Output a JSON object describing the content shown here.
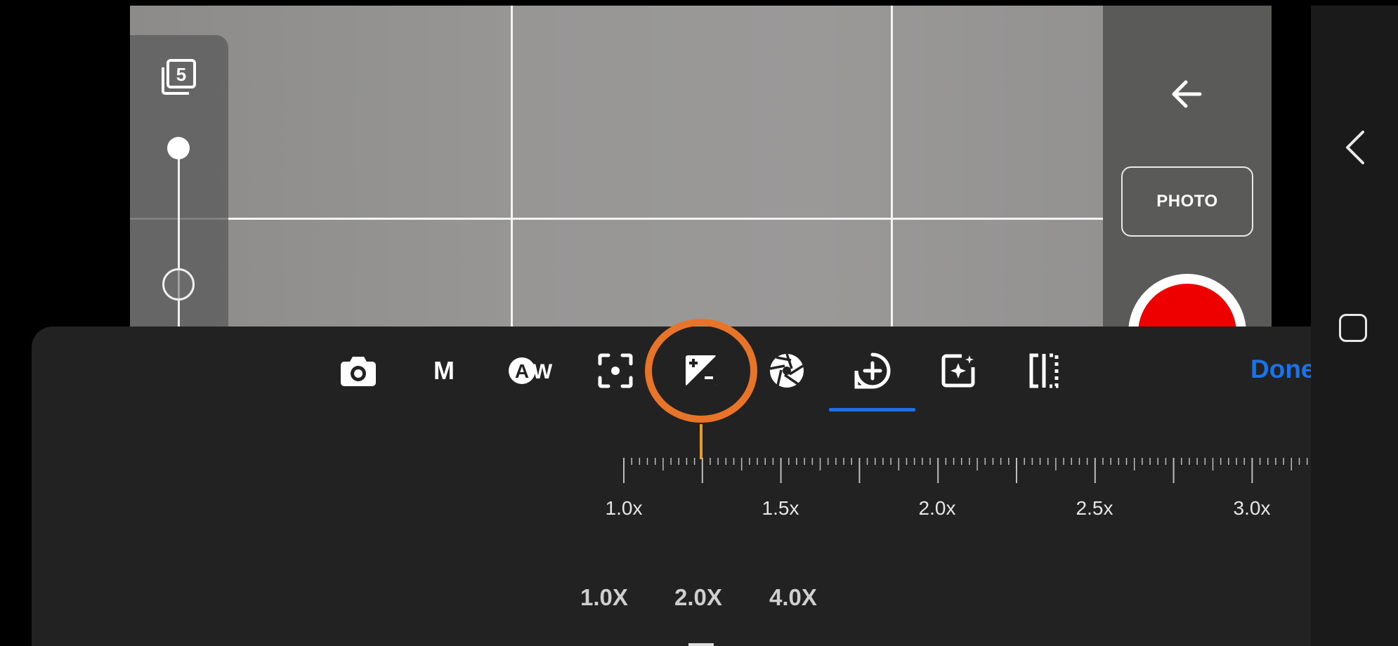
{
  "viewfinder": {
    "grid_lines": "3x2"
  },
  "left_panel": {
    "burst_count": "5",
    "burst_icon": "burst-stack-icon",
    "slider_level": 0.0
  },
  "right_panel": {
    "back_icon": "arrow-left-icon",
    "mode_button": "PHOTO",
    "record_icon": "record-button"
  },
  "system_nav": {
    "back_icon": "chevron-left-icon",
    "home_icon": "rounded-square-icon"
  },
  "toolbar": {
    "items": [
      {
        "name": "camera-icon",
        "label": ""
      },
      {
        "name": "manual-mode",
        "label": "M"
      },
      {
        "name": "auto-white-balance-icon",
        "label": "A",
        "suffix": "W"
      },
      {
        "name": "focus-icon",
        "label": ""
      },
      {
        "name": "exposure-compensation-icon",
        "label": ""
      },
      {
        "name": "aperture-icon",
        "label": ""
      },
      {
        "name": "zoom-icon",
        "label": ""
      },
      {
        "name": "effects-icon",
        "label": ""
      },
      {
        "name": "mirror-icon",
        "label": ""
      }
    ],
    "active_tab": "zoom-icon",
    "highlighted_tab": "exposure-compensation-icon",
    "done_label": "Done"
  },
  "zoom_ruler": {
    "labels": [
      "1.0x",
      "1.5x",
      "2.0x",
      "2.5x",
      "3.0x"
    ],
    "end_glyph": "|||",
    "current_value": "1.25x"
  },
  "presets": [
    "1.0X",
    "2.0X",
    "4.0X"
  ],
  "colors": {
    "accent_blue": "#1a73e8",
    "highlight_orange": "#e8742a",
    "record_red": "#ee0000",
    "sheet_bg": "#222222"
  }
}
